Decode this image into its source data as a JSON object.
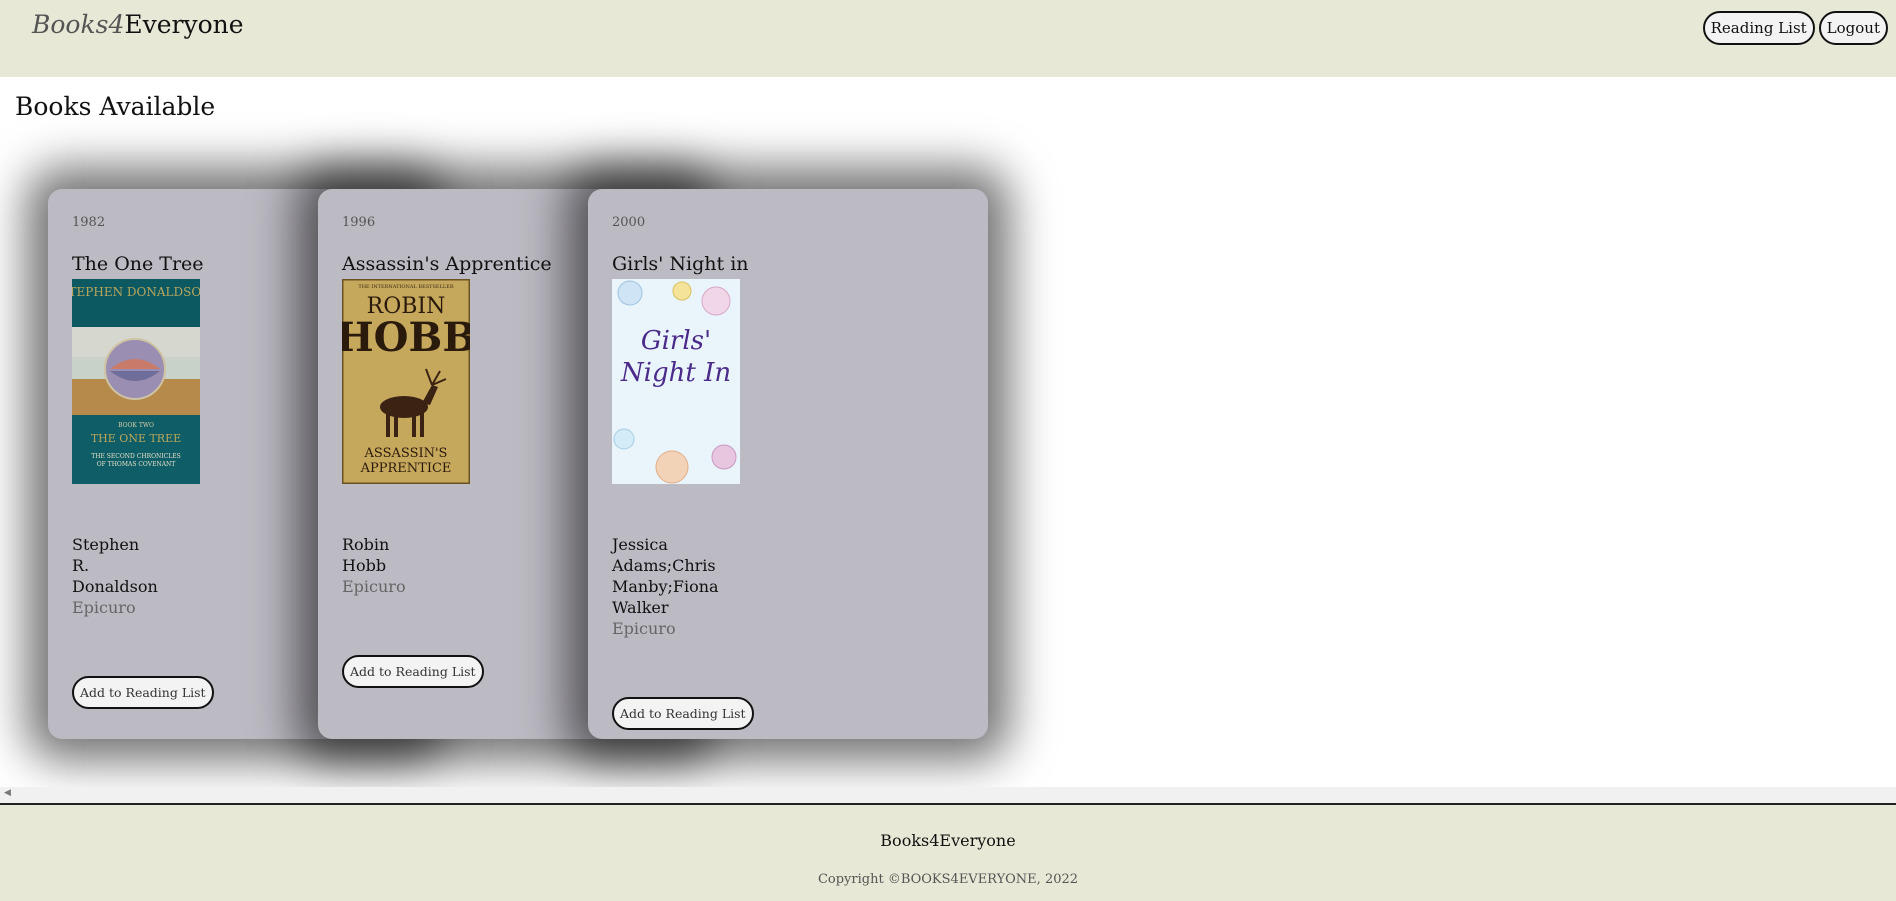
{
  "header": {
    "brand_italic": "Books4",
    "brand_rest": "Everyone",
    "nav": {
      "reading_list": "Reading List",
      "logout": "Logout"
    }
  },
  "main": {
    "title": "Books Available",
    "books": [
      {
        "year": "1982",
        "title": "The One Tree",
        "author_lines": [
          "Stephen",
          "R.",
          "Donaldson"
        ],
        "publisher": "Epicuro",
        "button": "Add to Reading List",
        "cover": {
          "type": "painted-book-cover",
          "author": "STEPHEN DONALDSON",
          "series_label": "BOOK TWO",
          "title": "THE ONE TREE",
          "subtitle_line1": "THE SECOND CHRONICLES",
          "subtitle_line2": "OF THOMAS COVENANT"
        }
      },
      {
        "year": "1996",
        "title": "Assassin's Apprentice",
        "author_lines": [
          "Robin",
          "Hobb"
        ],
        "publisher": "Epicuro",
        "button": "Add to Reading List",
        "cover": {
          "type": "stag-book-cover",
          "banner": "THE INTERNATIONAL BESTSELLER",
          "author_line1": "ROBIN",
          "author_line2": "HOBB",
          "title_line1": "ASSASSIN'S",
          "title_line2": "APPRENTICE"
        }
      },
      {
        "year": "2000",
        "title": "Girls' Night in",
        "author_lines": [
          "Jessica",
          "Adams;Chris",
          "Manby;Fiona",
          "Walker"
        ],
        "publisher": "Epicuro",
        "button": "Add to Reading List",
        "cover": {
          "type": "bubbles-book-cover",
          "title_line1": "Girls'",
          "title_line2": "Night In"
        }
      }
    ]
  },
  "footer": {
    "brand": "Books4Everyone",
    "copyright": "Copyright ©BOOKS4EVERYONE, 2022"
  },
  "colors": {
    "header_bg": "#e8e8d6",
    "card_bg": "#bcbac2",
    "page_bg": "#ffffff"
  }
}
